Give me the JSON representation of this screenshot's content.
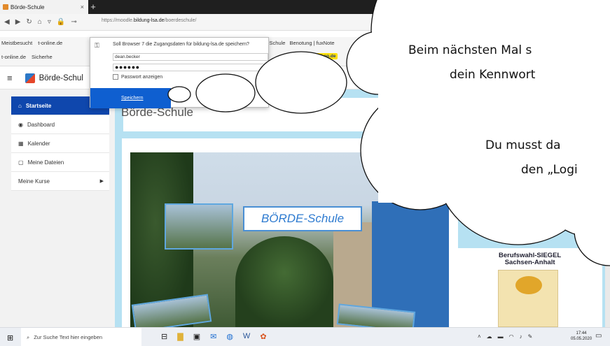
{
  "browser": {
    "tab_title": "Börde-Schule",
    "tab_close": "×",
    "new_tab": "+",
    "url_prefix": "https://moodle.",
    "url_domain": "bildung-lsa.de",
    "url_path": "/boerdeschule/",
    "bookmarks_row1": [
      "Meistbesucht",
      "t-online.de"
    ],
    "bookmarks_row1_right": [
      "-Schule",
      "Benotung | fuxNote"
    ],
    "bookmarks_row2": [
      "t-online.de",
      "Sicherhe"
    ],
    "otto": "OTTO",
    "lidl": "lidl-shop.de"
  },
  "password_popup": {
    "title": "Soll Browser 7 die Zugangsdaten für bildung-lsa.de speichern?",
    "username": "dean.becker",
    "password_mask": "●●●●●●",
    "show_password": "Passwort anzeigen",
    "save_button": "Speichern"
  },
  "header": {
    "site_name": "Börde-Schul"
  },
  "sidebar": {
    "items": [
      {
        "icon": "home-icon",
        "label": "Startseite",
        "glyph": "⌂",
        "active": true
      },
      {
        "icon": "dashboard-icon",
        "label": "Dashboard",
        "glyph": "◉",
        "active": false
      },
      {
        "icon": "calendar-icon",
        "label": "Kalender",
        "glyph": "▦",
        "active": false
      },
      {
        "icon": "file-icon",
        "label": "Meine Dateien",
        "glyph": "▢",
        "active": false
      },
      {
        "icon": "courses-icon",
        "label": "Meine Kurse",
        "glyph": "",
        "active": false
      }
    ]
  },
  "main": {
    "page_title": "Börde-Schule",
    "school_sign": "BÖRDE-Schule",
    "siegel_line1": "Berufswahl-SIEGEL",
    "siegel_line2": "Sachsen-Anhalt"
  },
  "annotation": {
    "line1": "Beim nächsten Mal s",
    "line2": "dein Kennwort",
    "line3": "Du musst da",
    "line4": "den „Logi"
  },
  "taskbar": {
    "search_placeholder": "Zur Suche Text hier eingeben",
    "time": "17:44",
    "date": "05.05.2020"
  },
  "colors": {
    "accent_blue": "#0f47ad",
    "page_bg_blue": "#b6e1f2",
    "save_button": "#0f5fd0"
  }
}
